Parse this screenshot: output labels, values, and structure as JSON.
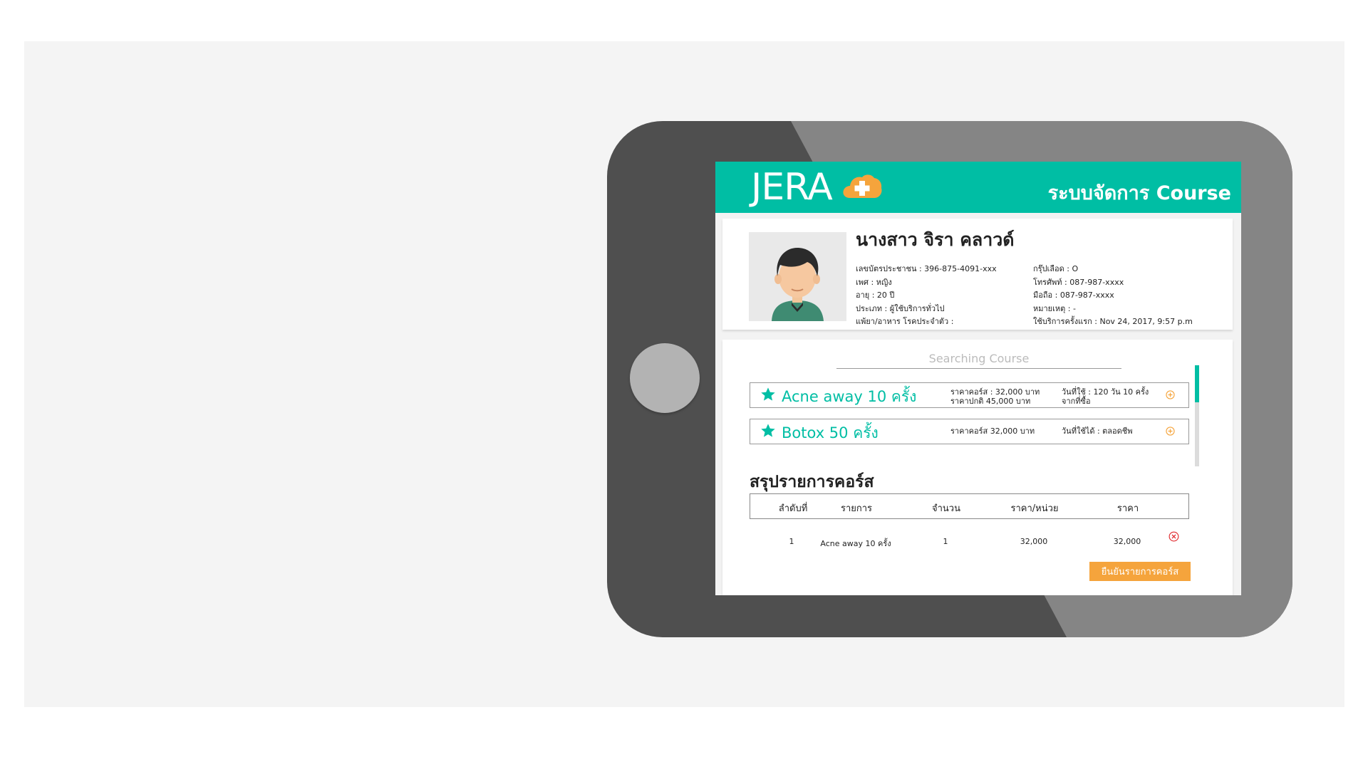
{
  "app": {
    "brand": "JERA",
    "title": "ระบบจัดการ Course"
  },
  "patient": {
    "name": "นางสาว จิรา คลาวด์",
    "info_left": [
      "เลขบัตรประชาชน : 396-875-4091-xxx",
      "เพศ : หญิง",
      "อายุ : 20 ปี",
      "ประเภท : ผู้ใช้บริการทั่วไป",
      "แพ้ยา/อาหาร โรคประจำตัว :"
    ],
    "info_right": [
      "กรุ๊ปเลือด : O",
      "โทรศัพท์ : 087-987-xxxx",
      "มือถือ : 087-987-xxxx",
      "หมายเหตุ : -",
      "ใช้บริการครั้งแรก : Nov 24, 2017, 9:57 p.m"
    ]
  },
  "search": {
    "placeholder": "Searching Course"
  },
  "courses": [
    {
      "name": "Acne away 10 ครั้ง",
      "price_line1": "ราคาคอร์ส : 32,000 บาท",
      "price_line2": "ราคาปกติ 45,000  บาท",
      "usage_line1": "วันที่ใช้ : 120  วัน   10 ครั้ง",
      "usage_line2": "จากที่ซื้อ"
    },
    {
      "name": "Botox 50 ครั้ง",
      "price_line1": "ราคาคอร์ส 32,000 บาท",
      "price_line2": "",
      "usage_line1": "วันที่ใช้ได้ : ตลอดชีพ",
      "usage_line2": ""
    }
  ],
  "summary": {
    "title": "สรุปรายการคอร์ส",
    "headers": [
      "ลำดับที่",
      "รายการ",
      "จำนวน",
      "ราคา/หน่วย",
      "ราคา"
    ],
    "rows": [
      [
        "1",
        "Acne away 10 ครั้ง",
        "1",
        "32,000",
        "32,000"
      ]
    ],
    "confirm_label": "ยืนยันรายการคอร์ส"
  },
  "colors": {
    "brand": "#00bea4",
    "accent": "#f5a43c",
    "remove": "#e0262b"
  },
  "icons": [
    "plus-cloud-icon",
    "star-icon",
    "add-circle-icon",
    "remove-circle-icon",
    "user-avatar"
  ]
}
